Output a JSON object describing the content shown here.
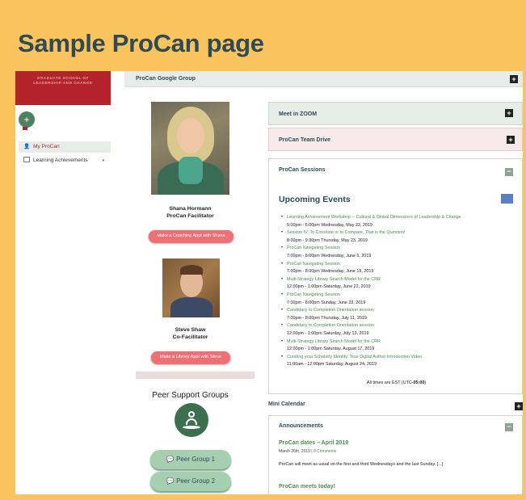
{
  "slide": {
    "title_a": "Sample ",
    "title_b": "ProCan",
    "title_c": " page"
  },
  "sidebar": {
    "logo_line1": "GRADUATE SCHOOL OF",
    "logo_line2": "LEADERSHIP AND CHANGE",
    "add_label": "+",
    "items": [
      {
        "label": "My ProCan"
      },
      {
        "label": "Learning Achievements"
      }
    ]
  },
  "main": {
    "google_group": "ProCan Google Group",
    "toggle_plus": "+",
    "toggle_minus": "−",
    "people": [
      {
        "name": "Shana Hormann",
        "role": "ProCan Facilitator",
        "button": "Make a Coaching Appt with Shana"
      },
      {
        "name": "Steve Shaw",
        "role": "Co-Facilitator",
        "button": "Make a Library Appt with Steve"
      }
    ],
    "peer": {
      "title": "Peer Support Groups",
      "groups": [
        {
          "label": "Peer Group 1"
        },
        {
          "label": "Peer Group 2"
        }
      ]
    },
    "panels": {
      "zoom": "Meet in ZOOM",
      "drive": "ProCan Team Drive",
      "sessions": "ProCan Sessions",
      "mini_calendar": "Mini Calendar",
      "announcements": "Announcements"
    },
    "upcoming_title": "Upcoming Events",
    "events": [
      {
        "title": "Learning Achievement Workshop -- Cultural & Global Dimensions of Leadership & Change",
        "time": "5:00pm - 6:00pm Wednesday, May 22, 2019"
      },
      {
        "title": "Session IV: To Correlate or to Compare, That is the Question!",
        "time": "8:00pm - 9:30pm Thursday, May 23, 2019"
      },
      {
        "title": "ProCan Navigating Session",
        "time": "7:00pm - 8:00pm Wednesday, June 5, 2019"
      },
      {
        "title": "ProCan Navigating Session",
        "time": "7:00pm - 8:00pm Wednesday, June 19, 2019"
      },
      {
        "title": "Multi-Strategy Library Search Model for the CRR",
        "time": "12:00pm - 1:00pm Saturday, June 22, 2019"
      },
      {
        "title": "ProCan Navigating Session",
        "time": "7:00pm - 8:00pm Sunday, June 23, 2019"
      },
      {
        "title": "Candidacy to Completion Orientation session",
        "time": "7:00pm - 8:00pm Thursday, July 11, 2019"
      },
      {
        "title": "Candidacy to Completion Orientation session",
        "time": "12:00pm - 1:00pm Saturday, July 13, 2019"
      },
      {
        "title": "Multi-Strategy Library Search Model for the CRR",
        "time": "12:00pm - 1:00pm Saturday, August 17, 2019"
      },
      {
        "title": "Curating your Scholarly Identity: Your Digital Author Introduction Video",
        "time": "11:00am - 12:00pm Saturday, August 24, 2019"
      }
    ],
    "times_note": "All times are EST (UTC",
    "times_note_offset": "-05:00",
    "times_note_end": ")",
    "announcement_items": [
      {
        "title": "ProCan dates – April 2019",
        "date": "March 26th, 2019 | ",
        "comments": "0 Comments",
        "body": "ProCan will meet as usual on the first and third Wednesdays and the last Sunday. [...]"
      },
      {
        "title": "ProCan meets today!"
      }
    ]
  }
}
